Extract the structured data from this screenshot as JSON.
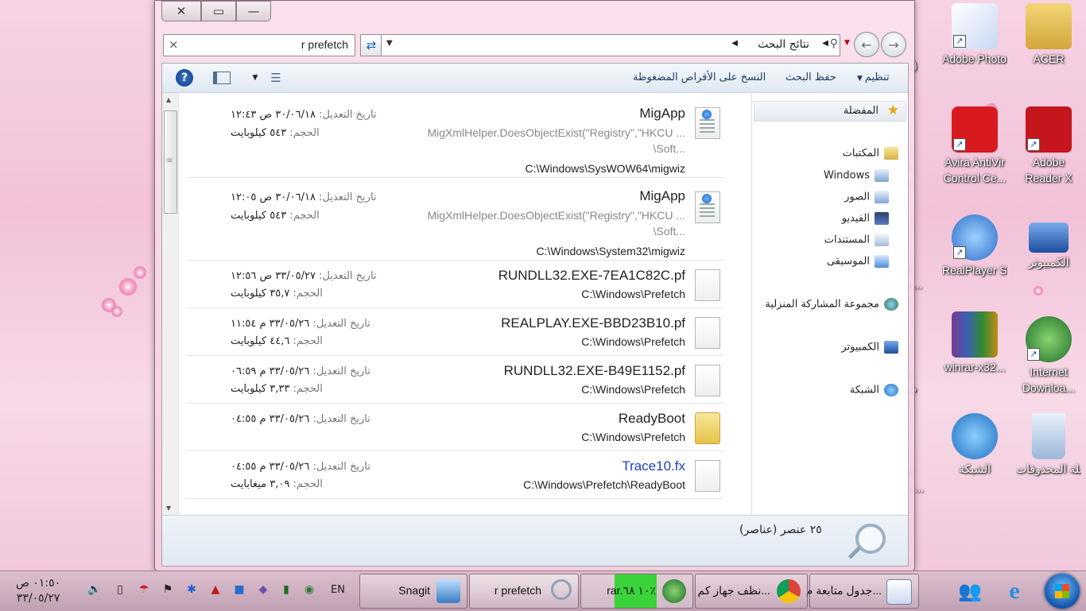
{
  "window": {
    "search": {
      "value": "r prefetch",
      "clear_icon": "close-icon"
    },
    "address": {
      "crumb": "نتائج البحث"
    },
    "toolbar": {
      "organize": "تنظيم",
      "save_search": "حفظ البحث",
      "burn": "النسخ على الأقراص المضغوطة"
    },
    "nav": {
      "favorites": "المفضلة",
      "libraries": "المكتبات",
      "lib_items": [
        "Windows",
        "الصور",
        "الفيديو",
        "المستندات",
        "الموسيقى"
      ],
      "homegroup": "مجموعة المشاركة المنزلية",
      "computer": "الكمبيوتر",
      "network": "الشبكة"
    },
    "labels": {
      "modified": "تاريخ التعديل:",
      "size": "الحجم:"
    },
    "files": [
      {
        "name": "MigApp",
        "snippet1": "MigXmlHelper.DoesObjectExist(\"Registry\",\"HKCU ...",
        "snippet2": "\\Soft...",
        "path": "C:\\Windows\\SysWOW64\\migwiz",
        "modified": "٣٠/٠٦/١٨ ص ١٢:٤٣",
        "size": "٥٤٣ كيلوبايت"
      },
      {
        "name": "MigApp",
        "snippet1": "MigXmlHelper.DoesObjectExist(\"Registry\",\"HKCU ...",
        "snippet2": "\\Soft...",
        "path": "C:\\Windows\\System32\\migwiz",
        "modified": "٣٠/٠٦/١٨ ص ١٢:٠٥",
        "size": "٥٤٣ كيلوبايت"
      },
      {
        "name": "RUNDLL32.EXE-7EA1C82C.pf",
        "path": "C:\\Windows\\Prefetch",
        "modified": "٣٣/٠٥/٢٧ ص ١٢:٥٦",
        "size": "٣٥,٧ كيلوبايت"
      },
      {
        "name": "REALPLAY.EXE-BBD23B10.pf",
        "path": "C:\\Windows\\Prefetch",
        "modified": "٣٣/٠٥/٢٦ م ١١:٥٤",
        "size": "٤٤,٦ كيلوبايت"
      },
      {
        "name": "RUNDLL32.EXE-B49E1152.pf",
        "path": "C:\\Windows\\Prefetch",
        "modified": "٣٣/٠٥/٢٦ م ٠٦:٥٩",
        "size": "٣,٣٣ كيلوبايت"
      },
      {
        "name": "ReadyBoot",
        "path": "C:\\Windows\\Prefetch",
        "modified": "٣٣/٠٥/٢٦ م ٠٤:٥٥"
      },
      {
        "name": "Trace10.fx",
        "path": "C:\\Windows\\Prefetch\\ReadyBoot",
        "modified": "٣٣/٠٥/٢٦ م ٠٤:٥٥",
        "size": "٣,٠٩ ميغابايت"
      }
    ],
    "status": {
      "count": "٢٥ عنصر (عناصر)"
    }
  },
  "desktop": {
    "icons": [
      {
        "label": "ACER",
        "color": "#d9b24a"
      },
      {
        "label": "Adobe Photosho...",
        "color": "#6b8fd0"
      },
      {
        "label": "Adobe Reader X",
        "color": "#c4161c"
      },
      {
        "label": "Avira AntiVir Control Ce...",
        "color": "#d71920"
      },
      {
        "label": "الكمبيوتر",
        "color": "#4a7fd1"
      },
      {
        "label": "RealPlayer SP",
        "color": "#2d6ec7"
      },
      {
        "label": "Internet Downloa...",
        "color": "#2f8a2f"
      },
      {
        "label": "winrar-x32...",
        "color": "#7a3a8f"
      },
      {
        "label": "سلة المحذوفات",
        "color": "#9bb7d8"
      },
      {
        "label": "الشبكة",
        "color": "#3a8fd1"
      }
    ],
    "partial_labels": [
      "(2)",
      "t",
      "y",
      "e",
      "Sc...",
      "إد",
      "مت",
      "الأ",
      "علة..."
    ]
  },
  "taskbar": {
    "tasks": [
      "جدول متابعة م...",
      "نظف جهاز كم...",
      "rar.١٠ ٦٨٪",
      "r prefetch",
      "Snagit"
    ],
    "lang": "EN",
    "clock_time": "٠١:٥٠ ص",
    "clock_date": "٣٣/٠٥/٢٧"
  }
}
